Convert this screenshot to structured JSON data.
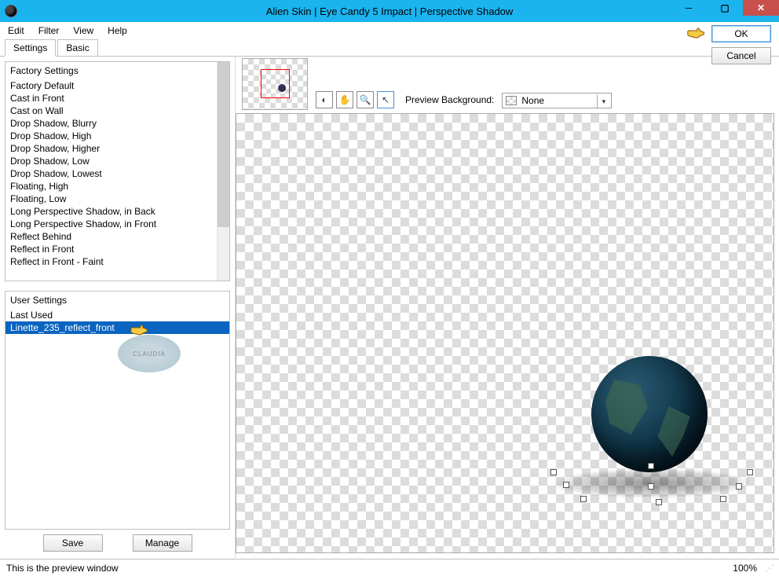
{
  "window": {
    "title": "Alien Skin | Eye Candy 5 Impact | Perspective Shadow"
  },
  "menu": {
    "edit": "Edit",
    "filter": "Filter",
    "view": "View",
    "help": "Help"
  },
  "tabs": {
    "settings": "Settings",
    "basic": "Basic"
  },
  "factory": {
    "header": "Factory Settings",
    "items": [
      "Factory Default",
      "Cast in Front",
      "Cast on Wall",
      "Drop Shadow, Blurry",
      "Drop Shadow, High",
      "Drop Shadow, Higher",
      "Drop Shadow, Low",
      "Drop Shadow, Lowest",
      "Floating, High",
      "Floating, Low",
      "Long Perspective Shadow, in Back",
      "Long Perspective Shadow, in Front",
      "Reflect Behind",
      "Reflect in Front",
      "Reflect in Front - Faint"
    ]
  },
  "user": {
    "header": "User Settings",
    "last_used": "Last Used",
    "selected": "Linette_235_reflect_front"
  },
  "buttons": {
    "save": "Save",
    "manage": "Manage",
    "ok": "OK",
    "cancel": "Cancel"
  },
  "preview": {
    "label": "Preview Background:",
    "value": "None"
  },
  "watermark": "CLAUDIA",
  "status": {
    "message": "This is the preview window",
    "zoom": "100%"
  }
}
